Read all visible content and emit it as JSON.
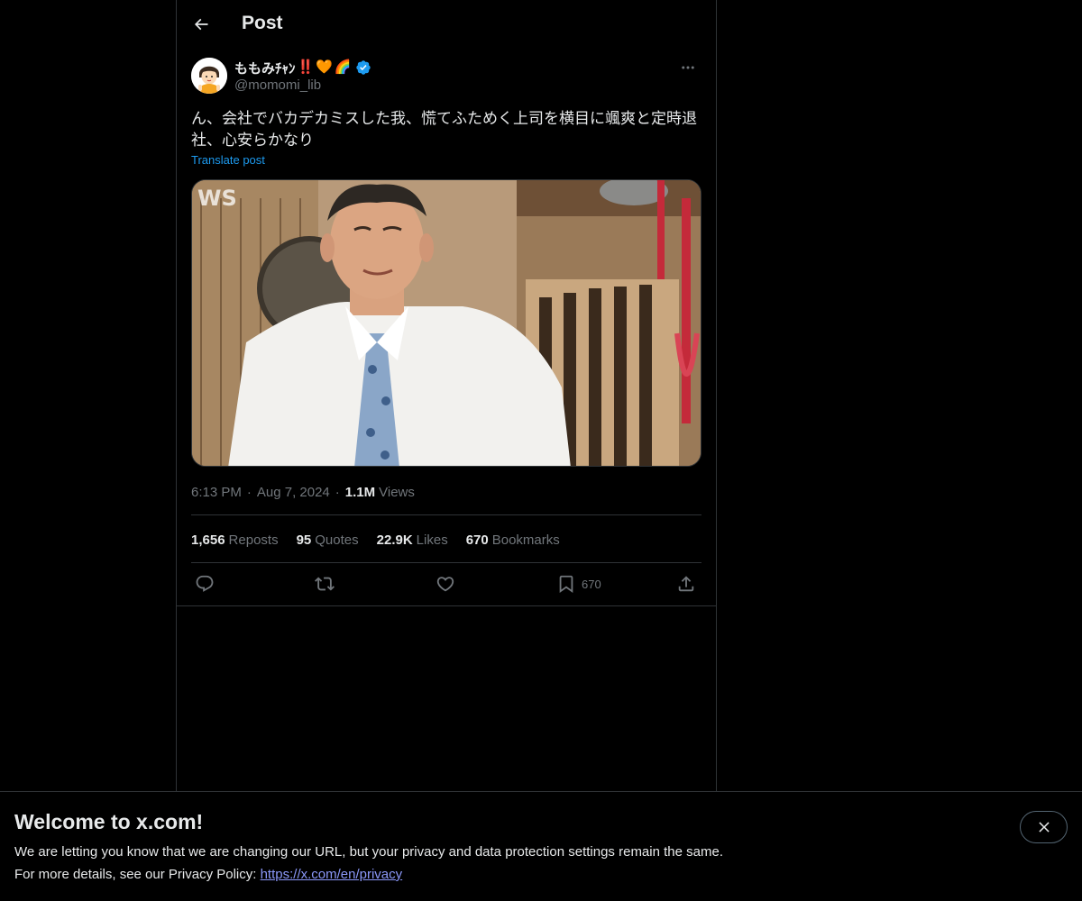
{
  "header": {
    "title": "Post",
    "back_icon": "arrow-left-icon"
  },
  "author": {
    "display_name": "ももみﾁｬﾝ",
    "emojis": [
      "‼️",
      "🧡",
      "🌈"
    ],
    "handle": "@momomi_lib",
    "verified": true,
    "verified_color": "#1d9bf0"
  },
  "post": {
    "text": "ん、会社でバカデカミスした我、慌てふためく上司を横目に颯爽と定時退社、心安らかなり",
    "translate_label": "Translate post",
    "media_watermark": "WS"
  },
  "meta": {
    "time": "6:13 PM",
    "date": "Aug 7, 2024",
    "views_count": "1.1M",
    "views_label": "Views"
  },
  "stats": [
    {
      "count": "1,656",
      "label": "Reposts"
    },
    {
      "count": "95",
      "label": "Quotes"
    },
    {
      "count": "22.9K",
      "label": "Likes"
    },
    {
      "count": "670",
      "label": "Bookmarks"
    }
  ],
  "actions": {
    "reply_icon": "reply-icon",
    "repost_icon": "repost-icon",
    "like_icon": "heart-icon",
    "bookmark_icon": "bookmark-icon",
    "bookmark_count": "670",
    "share_icon": "share-icon"
  },
  "banner": {
    "title": "Welcome to x.com!",
    "line1": "We are letting you know that we are changing our URL, but your privacy and data protection settings remain the same.",
    "line2_prefix": "For more details, see our Privacy Policy: ",
    "link": "https://x.com/en/privacy"
  },
  "colors": {
    "background": "#000000",
    "text": "#e7e9ea",
    "secondary": "#71767b",
    "accent": "#1d9bf0",
    "border": "#2f3336"
  }
}
